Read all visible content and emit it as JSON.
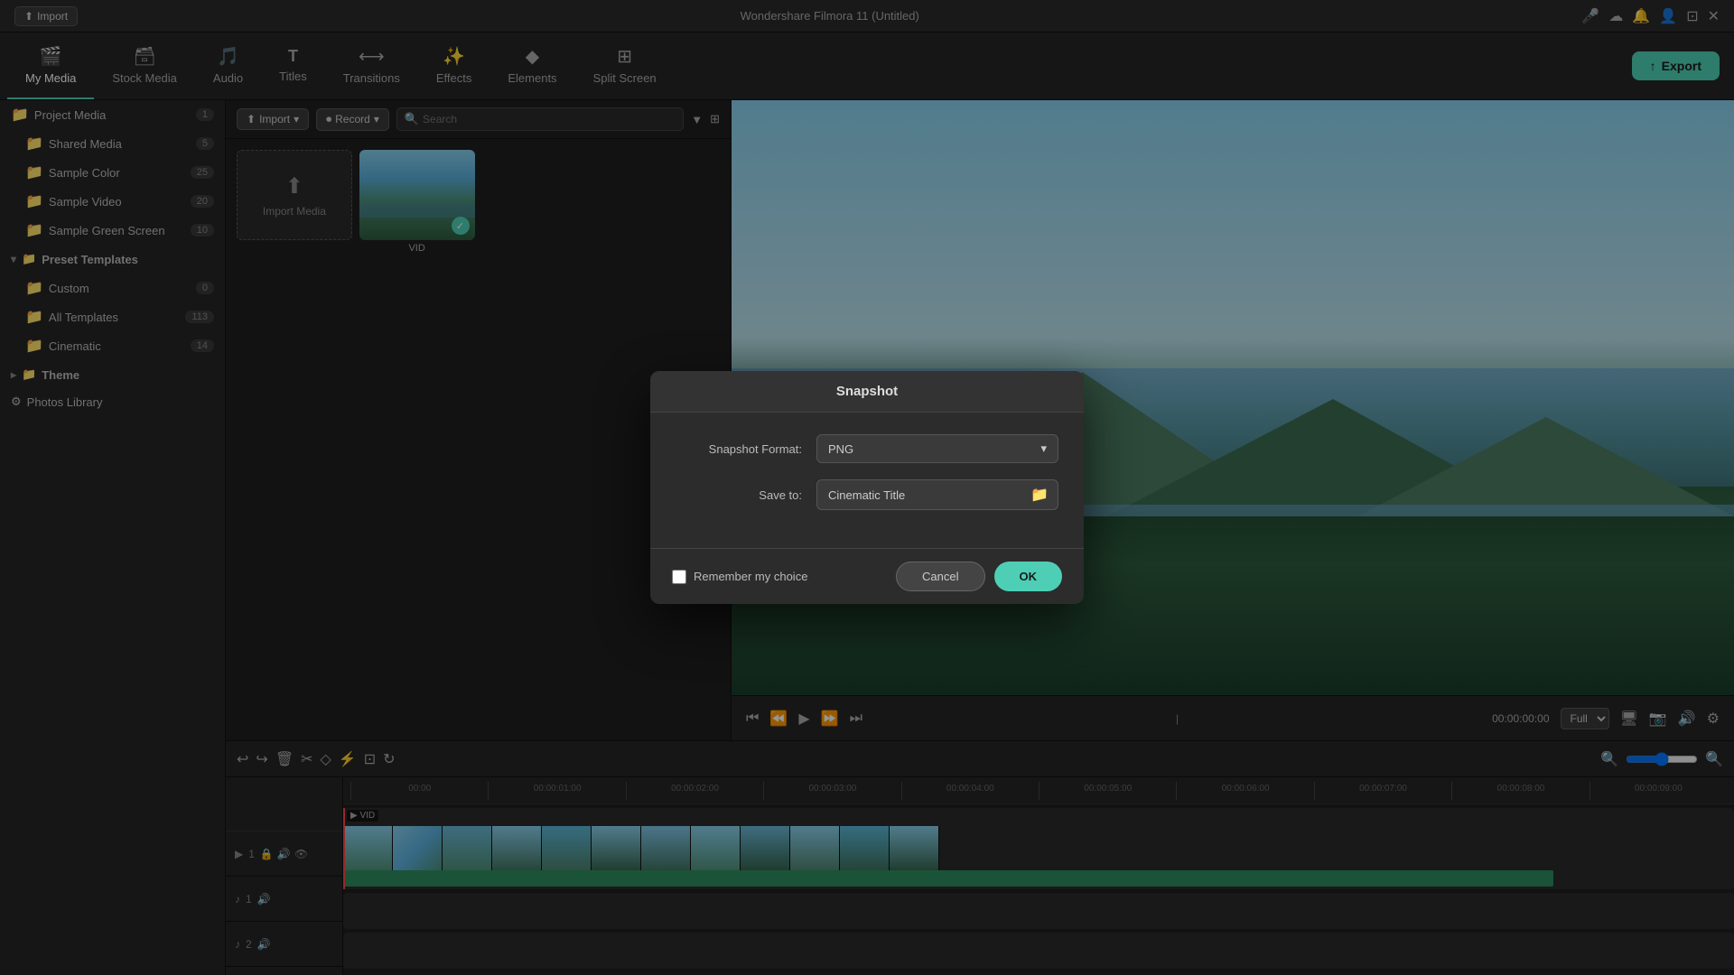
{
  "app": {
    "title": "Wondershare Filmora 11 (Untitled)"
  },
  "topbar": {
    "import_label": "Import"
  },
  "nav": {
    "tabs": [
      {
        "id": "my-media",
        "label": "My Media",
        "icon": "🎬",
        "active": true
      },
      {
        "id": "stock-media",
        "label": "Stock Media",
        "icon": "🗃"
      },
      {
        "id": "audio",
        "label": "Audio",
        "icon": "🎵"
      },
      {
        "id": "titles",
        "label": "Titles",
        "icon": "T"
      },
      {
        "id": "transitions",
        "label": "Transitions",
        "icon": "⟷"
      },
      {
        "id": "effects",
        "label": "Effects",
        "icon": "✨"
      },
      {
        "id": "elements",
        "label": "Elements",
        "icon": "◆"
      },
      {
        "id": "split-screen",
        "label": "Split Screen",
        "icon": "⊞"
      }
    ],
    "export_label": "Export"
  },
  "sidebar": {
    "project_media": {
      "label": "Project Media",
      "count": "1"
    },
    "shared_media": {
      "label": "Shared Media",
      "count": "5"
    },
    "sample_color": {
      "label": "Sample Color",
      "count": "25"
    },
    "sample_video": {
      "label": "Sample Video",
      "count": "20"
    },
    "sample_green_screen": {
      "label": "Sample Green Screen",
      "count": "10"
    },
    "preset_templates": {
      "label": "Preset Templates"
    },
    "custom": {
      "label": "Custom",
      "count": "0"
    },
    "all_templates": {
      "label": "All Templates",
      "count": "113"
    },
    "cinematic": {
      "label": "Cinematic",
      "count": "14"
    },
    "theme": {
      "label": "Theme"
    },
    "photos_library": {
      "label": "Photos Library"
    }
  },
  "media_panel": {
    "import_btn": "Import",
    "record_btn": "Record",
    "search_placeholder": "Search",
    "import_media_label": "Import Media",
    "vid_label": "VID"
  },
  "preview": {
    "time_display": "00:00:00:00",
    "quality": "Full"
  },
  "timeline": {
    "tracks": [
      {
        "id": "v1",
        "label": "▶ 1",
        "icons": [
          "🔊",
          "👁"
        ]
      },
      {
        "id": "a1",
        "label": "♪ 1",
        "icons": [
          "🔊"
        ]
      },
      {
        "id": "a2",
        "label": "♪ 2",
        "icons": [
          "🔊"
        ]
      }
    ],
    "ruler_marks": [
      "00:00",
      "00:00:01:00",
      "00:00:02:00",
      "00:00:03:00",
      "00:00:04:00",
      "00:00:05:00",
      "00:00:06:00",
      "00:00:07:00",
      "00:00:08:00",
      "00:00:09:00"
    ]
  },
  "snapshot_dialog": {
    "title": "Snapshot",
    "format_label": "Snapshot Format:",
    "format_value": "PNG",
    "save_to_label": "Save to:",
    "save_to_value": "Cinematic Title",
    "remember_label": "Remember my choice",
    "cancel_label": "Cancel",
    "ok_label": "OK"
  }
}
